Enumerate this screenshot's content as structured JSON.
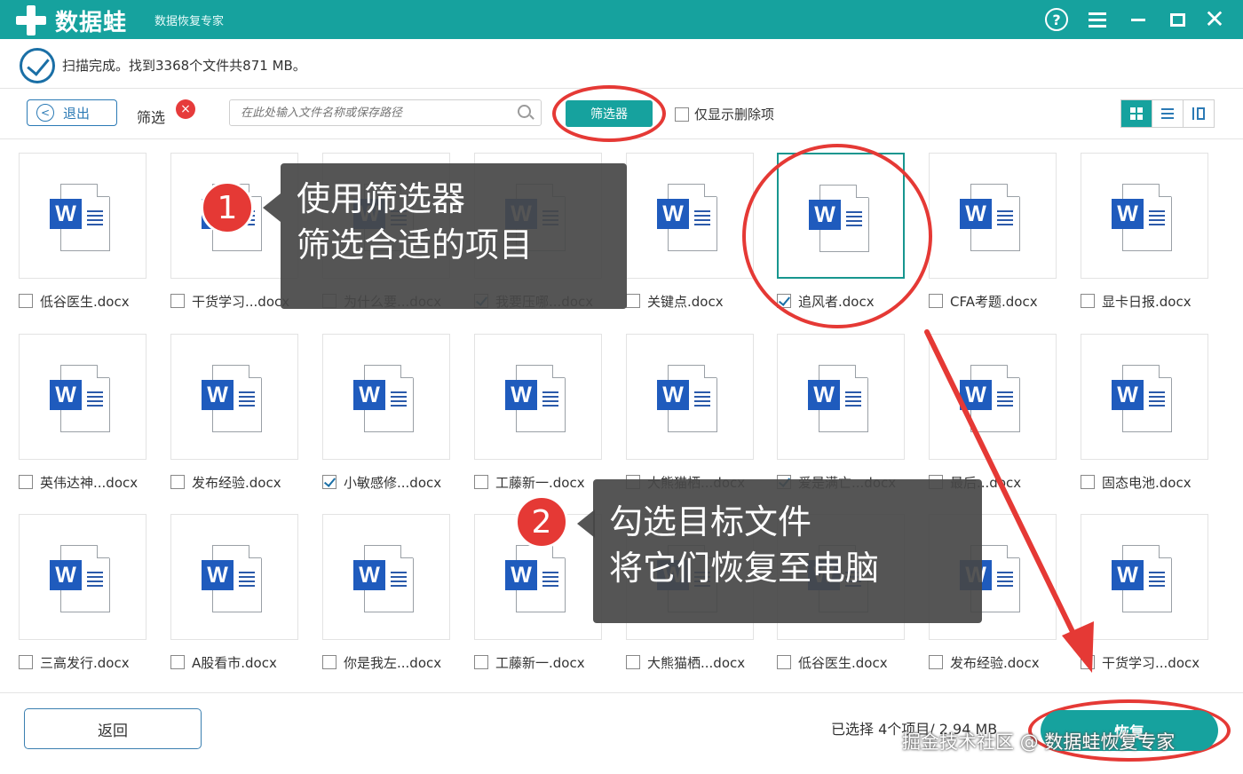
{
  "window": {
    "app_name": "数据蛙",
    "app_subtitle": "数据恢复专家",
    "help_glyph": "?",
    "close_glyph": "✕",
    "icons": [
      "help-icon",
      "menu-icon",
      "minimize-icon",
      "maximize-icon",
      "close-icon"
    ],
    "brand_color": "#16a29e"
  },
  "status": {
    "text": "扫描完成。找到3368个文件共871 MB。"
  },
  "toolbar": {
    "exit_label": "退出",
    "back_glyph": "<",
    "filter_label": "筛选",
    "filter_clear_glyph": "×",
    "search_placeholder": "在此处输入文件名称或保存路径",
    "filter_button": "筛选器",
    "only_deleted_label": "仅显示删除项",
    "only_deleted_checked": false,
    "view_modes": [
      "grid",
      "list",
      "detail"
    ],
    "active_view": "grid"
  },
  "files": [
    {
      "name": "低谷医生.docx",
      "checked": false
    },
    {
      "name": "干货学习...docx",
      "checked": false
    },
    {
      "name": "为什么要...docx",
      "checked": false
    },
    {
      "name": "我要压哪...docx",
      "checked": true
    },
    {
      "name": "关键点.docx",
      "checked": false
    },
    {
      "name": "追风者.docx",
      "checked": true
    },
    {
      "name": "CFA考题.docx",
      "checked": false
    },
    {
      "name": "显卡日报.docx",
      "checked": false
    },
    {
      "name": "英伟达神...docx",
      "checked": false
    },
    {
      "name": "发布经验.docx",
      "checked": false
    },
    {
      "name": "小敏感修...docx",
      "checked": true
    },
    {
      "name": "工藤新一.docx",
      "checked": false
    },
    {
      "name": "大熊猫栖...docx",
      "checked": false
    },
    {
      "name": "爱是满亡...docx",
      "checked": true
    },
    {
      "name": "最后...docx",
      "checked": false
    },
    {
      "name": "固态电池.docx",
      "checked": false
    },
    {
      "name": "三高发行.docx",
      "checked": false
    },
    {
      "name": "A股看市.docx",
      "checked": false
    },
    {
      "name": "你是我左...docx",
      "checked": false
    },
    {
      "name": "工藤新一.docx",
      "checked": false
    },
    {
      "name": "大熊猫栖...docx",
      "checked": false
    },
    {
      "name": "低谷医生.docx",
      "checked": false
    },
    {
      "name": "发布经验.docx",
      "checked": false
    },
    {
      "name": "干货学习...docx",
      "checked": false
    }
  ],
  "file_icon_letter": "W",
  "callouts": {
    "step1_number": "1",
    "step1_line1": "使用筛选器",
    "step1_line2": "筛选合适的项目",
    "step2_number": "2",
    "step2_line1": "勾选目标文件",
    "step2_line2": "将它们恢复至电脑",
    "highlight_color": "#e53935"
  },
  "footer": {
    "return_label": "返回",
    "selected_info": "已选择 4个项目/ 2.94 MB",
    "recover_label": "恢复",
    "watermark": "掘金技术社区 @ 数据蛙恢复专家"
  }
}
